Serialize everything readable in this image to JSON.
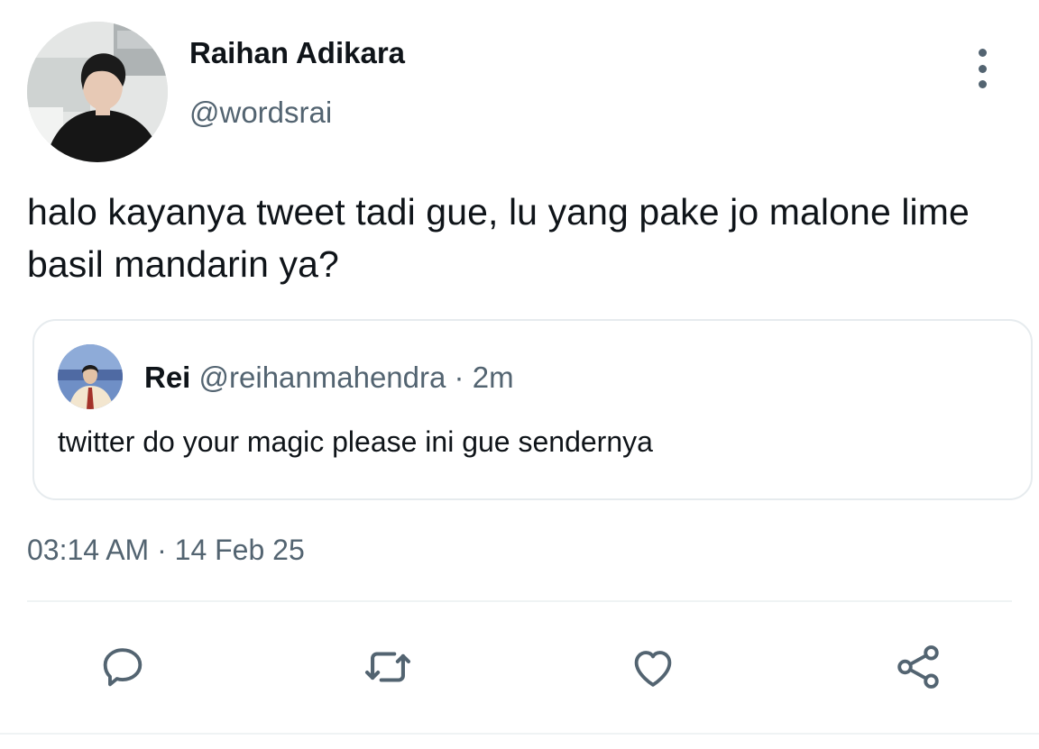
{
  "author": {
    "name": "Raihan Adikara",
    "handle": "@wordsrai"
  },
  "tweet": {
    "text": "halo kayanya tweet tadi gue, lu yang pake jo malone lime basil mandarin ya?",
    "timestamp": "03:14 AM",
    "separator": "·",
    "date": "14 Feb 25"
  },
  "quote": {
    "name": "Rei",
    "handle": "@reihanmahendra",
    "separator": "·",
    "time": "2m",
    "text": "twitter do your magic please ini gue sendernya"
  },
  "icons": {
    "more": "more-vertical-icon",
    "reply": "reply-icon",
    "retweet": "retweet-icon",
    "like": "heart-icon",
    "share": "share-icon"
  },
  "colors": {
    "text": "#0f1419",
    "secondary": "#536471",
    "border": "#e6ebee"
  }
}
